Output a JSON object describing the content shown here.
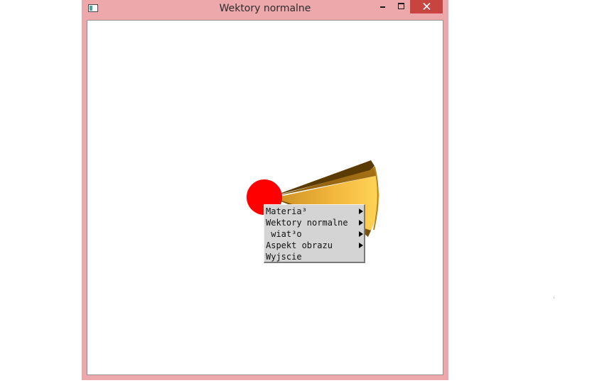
{
  "window": {
    "title": "Wektory normalne",
    "app_icon": "app-window-icon",
    "controls": {
      "minimize_icon": "minimize-icon",
      "maximize_icon": "maximize-icon",
      "close_icon": "close-icon"
    },
    "frame_color": "#eda8ac",
    "close_button_color": "#c7443f"
  },
  "scene": {
    "objects": [
      "sphere",
      "cone"
    ],
    "sphere_color": "#ff0000",
    "cone_color": "#f2b63c"
  },
  "context_menu": {
    "items": [
      {
        "label": "Materia³",
        "has_submenu": true
      },
      {
        "label": "Wektory normalne",
        "has_submenu": true
      },
      {
        "label": " wiat³o",
        "has_submenu": true
      },
      {
        "label": "Aspekt obrazu",
        "has_submenu": true
      },
      {
        "label": "Wyjscie",
        "has_submenu": false
      }
    ]
  }
}
